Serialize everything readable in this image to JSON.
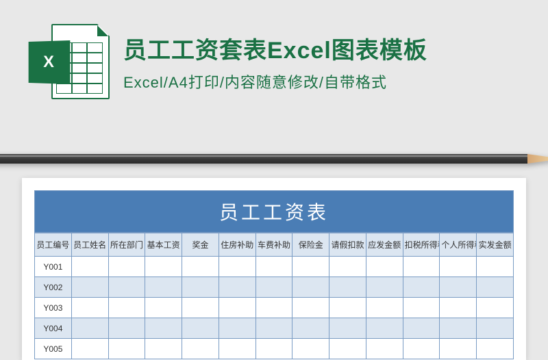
{
  "header": {
    "icon_badge": "X",
    "title": "员工工资套表Excel图表模板",
    "subtitle": "Excel/A4打印/内容随意修改/自带格式"
  },
  "sheet": {
    "title": "员工工资表",
    "columns": [
      "员工编号",
      "员工姓名",
      "所在部门",
      "基本工资",
      "奖金",
      "住房补助",
      "车费补助",
      "保险金",
      "请假扣款",
      "应发金额",
      "扣税所得税",
      "个人所得税",
      "实发金额"
    ],
    "rows": [
      {
        "id": "Y001",
        "cells": [
          "",
          "",
          "",
          "",
          "",
          "",
          "",
          "",
          "",
          "",
          "",
          ""
        ]
      },
      {
        "id": "Y002",
        "cells": [
          "",
          "",
          "",
          "",
          "",
          "",
          "",
          "",
          "",
          "",
          "",
          ""
        ]
      },
      {
        "id": "Y003",
        "cells": [
          "",
          "",
          "",
          "",
          "",
          "",
          "",
          "",
          "",
          "",
          "",
          ""
        ]
      },
      {
        "id": "Y004",
        "cells": [
          "",
          "",
          "",
          "",
          "",
          "",
          "",
          "",
          "",
          "",
          "",
          ""
        ]
      },
      {
        "id": "Y005",
        "cells": [
          "",
          "",
          "",
          "",
          "",
          "",
          "",
          "",
          "",
          "",
          "",
          ""
        ]
      }
    ]
  }
}
